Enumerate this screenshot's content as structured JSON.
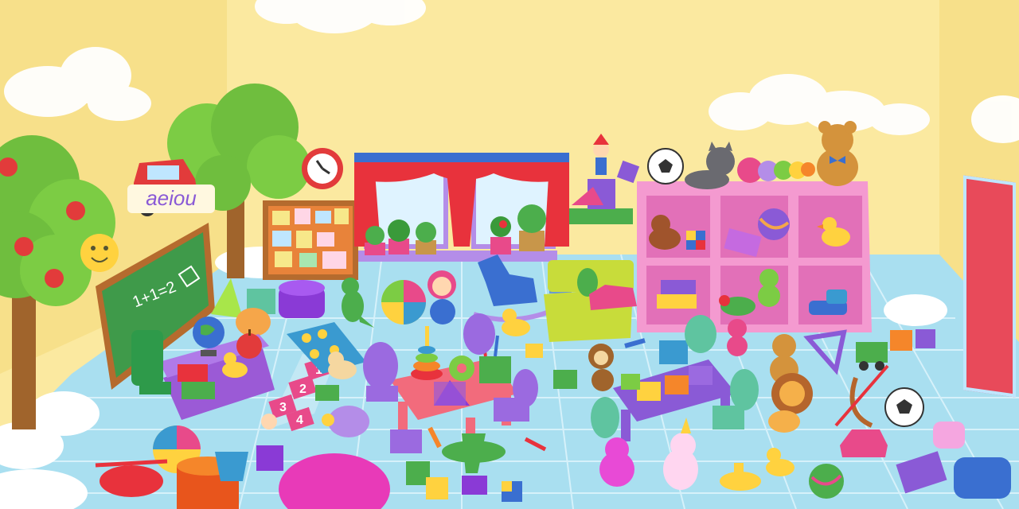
{
  "scene": {
    "name": "hidden object playroom",
    "colors": {
      "wall": "#fbe9a0",
      "floor": "#a9dff0",
      "floor_grid": "#d6f1fa",
      "cloud": "#ffffff",
      "curtain": "#e8323c",
      "shelf": "#f49ad0",
      "board": "#3f9a4a",
      "table_pink": "#f26b7c",
      "table_purple": "#8a5ad6"
    }
  },
  "chalkboard": {
    "equation": "1+1=2"
  },
  "wall_letters": "aeiou",
  "hopscotch": {
    "numbers": [
      "1",
      "2",
      "3",
      "4"
    ]
  },
  "icons": [
    "apple-tree-icon",
    "car-sticker-icon",
    "sun-smiley-icon",
    "clock-icon",
    "corkboard-icon",
    "window-curtain-icon",
    "potted-plant-icon",
    "toy-shelf-icon",
    "teddy-bear-icon",
    "cat-toy-icon",
    "soccer-ball-icon",
    "caterpillar-toy-icon",
    "jack-in-the-box-icon",
    "clown-toy-icon",
    "rag-doll-icon",
    "rocking-horse-icon",
    "robot-toy-icon",
    "dinosaur-toy-icon",
    "beach-ball-icon",
    "globe-icon",
    "rubber-duck-icon",
    "building-block-icon",
    "ring-stacker-icon",
    "pencil-cup-icon",
    "puzzle-piece-icon",
    "monkey-toy-icon",
    "lion-toy-icon",
    "elephant-toy-icon",
    "unicorn-toy-icon",
    "submarine-toy-icon",
    "yarn-ball-icon",
    "notebook-icon",
    "pillow-icon",
    "toy-car-icon",
    "airplane-toy-icon",
    "helicopter-toy-icon",
    "bow-and-arrow-icon",
    "train-toy-icon",
    "coat-hanger-icon",
    "rubiks-cube-icon",
    "turtle-toy-icon",
    "tiger-toy-icon",
    "bucket-icon",
    "drum-icon",
    "cupcake-cushion-icon"
  ]
}
